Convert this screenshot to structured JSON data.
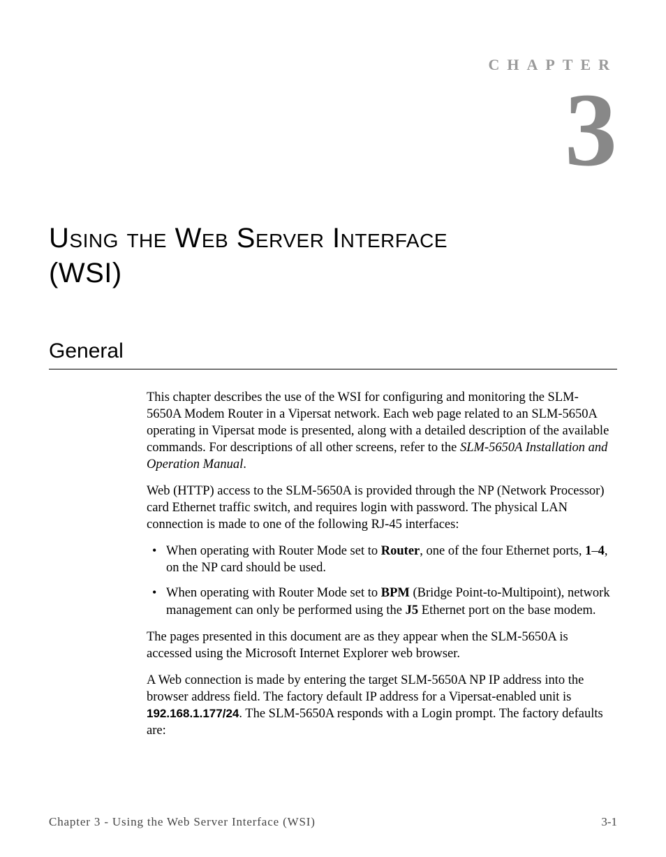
{
  "chapter": {
    "label": "CHAPTER",
    "number": "3",
    "title_part_1": "Using the Web Server Interface",
    "title_part_2": "(WSI)"
  },
  "section": {
    "heading": "General"
  },
  "paragraphs": {
    "p1_prefix": "This chapter describes the use of the WSI for configuring and monitoring the SLM-5650A Modem Router in a Vipersat network. Each web page related to an SLM-5650A operating in Vipersat mode is presented, along with a detailed description of the available commands. For descriptions of all other screens, refer to the ",
    "p1_italic": "SLM-5650A Installation and Operation Manual",
    "p1_suffix": ".",
    "p2": "Web (HTTP) access to the SLM-5650A is provided through the NP (Network Processor) card Ethernet traffic switch, and requires login with password. The physical LAN connection is made to one of the following RJ-45 interfaces:",
    "bullet1_prefix": "When operating with Router Mode set to ",
    "bullet1_bold1": "Router",
    "bullet1_mid1": ", one of the four Ethernet ports, ",
    "bullet1_bold2": "1",
    "bullet1_dash": "–",
    "bullet1_bold3": "4",
    "bullet1_suffix": ", on the NP card should be used.",
    "bullet2_prefix": "When operating with Router Mode set to ",
    "bullet2_bold1": "BPM",
    "bullet2_mid": " (Bridge Point-to-Multipoint), network management can only be performed using the ",
    "bullet2_bold2": "J5",
    "bullet2_suffix": " Ethernet port on the base modem.",
    "p3": "The pages presented in this document are as they appear when the SLM-5650A is accessed using the Microsoft Internet Explorer web browser.",
    "p4_prefix": "A Web connection is made by entering the target SLM-5650A NP IP address into the browser address field. The factory default IP address for a Vipersat-enabled unit is ",
    "p4_bold": "192.168.1.177/24",
    "p4_suffix": ". The SLM-5650A responds with a Login prompt. The factory defaults are:"
  },
  "footer": {
    "left": "Chapter 3 - Using the Web Server Interface (WSI)",
    "right": "3-1"
  }
}
